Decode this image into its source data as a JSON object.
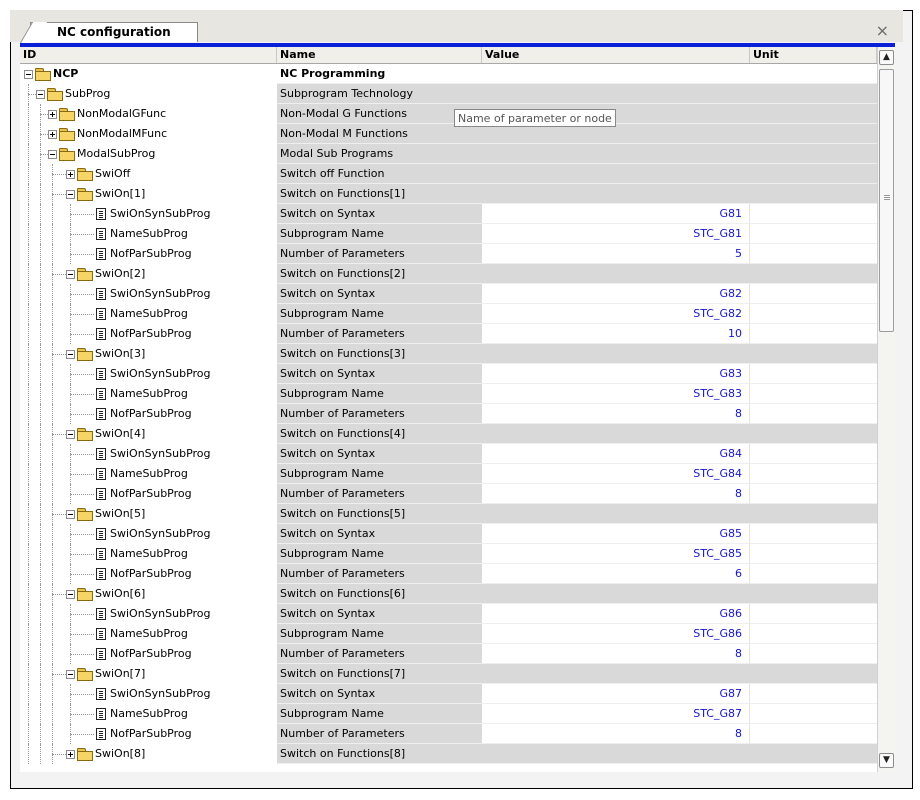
{
  "window": {
    "tab_title": "NC configuration",
    "close_glyph": "×"
  },
  "columns": {
    "id": "ID",
    "name": "Name",
    "value": "Value",
    "unit": "Unit"
  },
  "tooltip": "Name of parameter or node",
  "scrollbar": {
    "up_glyph": "▲",
    "down_glyph": "▼"
  },
  "rows": [
    {
      "id": "NCP",
      "name": "NC Programming",
      "value": "",
      "unit": "",
      "kind": "root",
      "level": 0,
      "expander": "minus"
    },
    {
      "id": "SubProg",
      "name": "Subprogram Technology",
      "value": "",
      "unit": "",
      "kind": "node",
      "level": 1,
      "expander": "minus"
    },
    {
      "id": "NonModalGFunc",
      "name": "Non-Modal G Functions",
      "value": "",
      "unit": "",
      "kind": "node",
      "level": 2,
      "expander": "plus"
    },
    {
      "id": "NonModalMFunc",
      "name": "Non-Modal M Functions",
      "value": "",
      "unit": "",
      "kind": "node",
      "level": 2,
      "expander": "plus"
    },
    {
      "id": "ModalSubProg",
      "name": "Modal Sub Programs",
      "value": "",
      "unit": "",
      "kind": "node",
      "level": 2,
      "expander": "minus"
    },
    {
      "id": "SwiOff",
      "name": "Switch off Function",
      "value": "",
      "unit": "",
      "kind": "node",
      "level": 3,
      "expander": "plus"
    },
    {
      "id": "SwiOn[1]",
      "name": "Switch on Functions[1]",
      "value": "",
      "unit": "",
      "kind": "node",
      "level": 3,
      "expander": "minus"
    },
    {
      "id": "SwiOnSynSubProg",
      "name": "Switch on Syntax",
      "value": "G81",
      "unit": "",
      "kind": "leaf",
      "level": 4
    },
    {
      "id": "NameSubProg",
      "name": "Subprogram Name",
      "value": "STC_G81",
      "unit": "",
      "kind": "leaf",
      "level": 4
    },
    {
      "id": "NofParSubProg",
      "name": "Number of Parameters",
      "value": "5",
      "unit": "",
      "kind": "leaf",
      "level": 4
    },
    {
      "id": "SwiOn[2]",
      "name": "Switch on Functions[2]",
      "value": "",
      "unit": "",
      "kind": "node",
      "level": 3,
      "expander": "minus"
    },
    {
      "id": "SwiOnSynSubProg",
      "name": "Switch on Syntax",
      "value": "G82",
      "unit": "",
      "kind": "leaf",
      "level": 4
    },
    {
      "id": "NameSubProg",
      "name": "Subprogram Name",
      "value": "STC_G82",
      "unit": "",
      "kind": "leaf",
      "level": 4
    },
    {
      "id": "NofParSubProg",
      "name": "Number of Parameters",
      "value": "10",
      "unit": "",
      "kind": "leaf",
      "level": 4
    },
    {
      "id": "SwiOn[3]",
      "name": "Switch on Functions[3]",
      "value": "",
      "unit": "",
      "kind": "node",
      "level": 3,
      "expander": "minus"
    },
    {
      "id": "SwiOnSynSubProg",
      "name": "Switch on Syntax",
      "value": "G83",
      "unit": "",
      "kind": "leaf",
      "level": 4
    },
    {
      "id": "NameSubProg",
      "name": "Subprogram Name",
      "value": "STC_G83",
      "unit": "",
      "kind": "leaf",
      "level": 4
    },
    {
      "id": "NofParSubProg",
      "name": "Number of Parameters",
      "value": "8",
      "unit": "",
      "kind": "leaf",
      "level": 4
    },
    {
      "id": "SwiOn[4]",
      "name": "Switch on Functions[4]",
      "value": "",
      "unit": "",
      "kind": "node",
      "level": 3,
      "expander": "minus"
    },
    {
      "id": "SwiOnSynSubProg",
      "name": "Switch on Syntax",
      "value": "G84",
      "unit": "",
      "kind": "leaf",
      "level": 4
    },
    {
      "id": "NameSubProg",
      "name": "Subprogram Name",
      "value": "STC_G84",
      "unit": "",
      "kind": "leaf",
      "level": 4
    },
    {
      "id": "NofParSubProg",
      "name": "Number of Parameters",
      "value": "8",
      "unit": "",
      "kind": "leaf",
      "level": 4
    },
    {
      "id": "SwiOn[5]",
      "name": "Switch on Functions[5]",
      "value": "",
      "unit": "",
      "kind": "node",
      "level": 3,
      "expander": "minus"
    },
    {
      "id": "SwiOnSynSubProg",
      "name": "Switch on Syntax",
      "value": "G85",
      "unit": "",
      "kind": "leaf",
      "level": 4
    },
    {
      "id": "NameSubProg",
      "name": "Subprogram Name",
      "value": "STC_G85",
      "unit": "",
      "kind": "leaf",
      "level": 4
    },
    {
      "id": "NofParSubProg",
      "name": "Number of Parameters",
      "value": "6",
      "unit": "",
      "kind": "leaf",
      "level": 4
    },
    {
      "id": "SwiOn[6]",
      "name": "Switch on Functions[6]",
      "value": "",
      "unit": "",
      "kind": "node",
      "level": 3,
      "expander": "minus"
    },
    {
      "id": "SwiOnSynSubProg",
      "name": "Switch on Syntax",
      "value": "G86",
      "unit": "",
      "kind": "leaf",
      "level": 4
    },
    {
      "id": "NameSubProg",
      "name": "Subprogram Name",
      "value": "STC_G86",
      "unit": "",
      "kind": "leaf",
      "level": 4
    },
    {
      "id": "NofParSubProg",
      "name": "Number of Parameters",
      "value": "8",
      "unit": "",
      "kind": "leaf",
      "level": 4
    },
    {
      "id": "SwiOn[7]",
      "name": "Switch on Functions[7]",
      "value": "",
      "unit": "",
      "kind": "node",
      "level": 3,
      "expander": "minus"
    },
    {
      "id": "SwiOnSynSubProg",
      "name": "Switch on Syntax",
      "value": "G87",
      "unit": "",
      "kind": "leaf",
      "level": 4
    },
    {
      "id": "NameSubProg",
      "name": "Subprogram Name",
      "value": "STC_G87",
      "unit": "",
      "kind": "leaf",
      "level": 4
    },
    {
      "id": "NofParSubProg",
      "name": "Number of Parameters",
      "value": "8",
      "unit": "",
      "kind": "leaf",
      "level": 4
    },
    {
      "id": "SwiOn[8]",
      "name": "Switch on Functions[8]",
      "value": "",
      "unit": "",
      "kind": "node",
      "level": 3,
      "expander": "plus"
    }
  ]
}
